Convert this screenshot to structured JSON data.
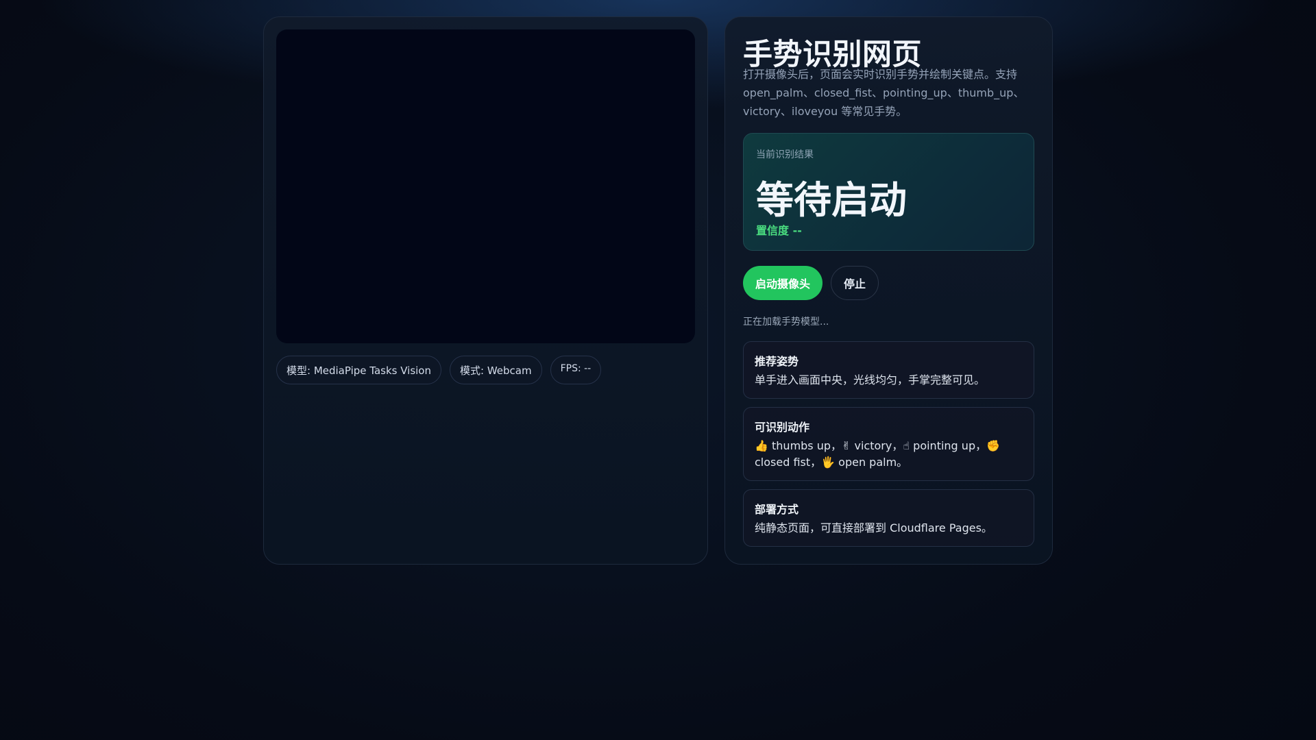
{
  "video_panel": {
    "chips": {
      "model": "模型: MediaPipe Tasks Vision",
      "mode": "模式: Webcam",
      "fps": "FPS: --"
    }
  },
  "info_panel": {
    "title": "手势识别网页",
    "description": "打开摄像头后，页面会实时识别手势并绘制关键点。支持 open_palm、closed_fist、pointing_up、thumb_up、victory、iloveyou 等常见手势。",
    "result": {
      "label": "当前识别结果",
      "value": "等待启动",
      "confidence": "置信度 --"
    },
    "buttons": {
      "start": "启动摄像头",
      "stop": "停止"
    },
    "status": "正在加载手势模型...",
    "cards": [
      {
        "title": "推荐姿势",
        "text": "单手进入画面中央，光线均匀，手掌完整可见。"
      },
      {
        "title": "可识别动作",
        "text": "👍 thumbs up，✌ victory，☝ pointing up，✊ closed fist，🖐 open palm。"
      },
      {
        "title": "部署方式",
        "text": "纯静态页面，可直接部署到 Cloudflare Pages。"
      }
    ]
  },
  "colors": {
    "accent": "#22c55e",
    "confidence": "#4ade80",
    "video_bg": "#020617"
  }
}
